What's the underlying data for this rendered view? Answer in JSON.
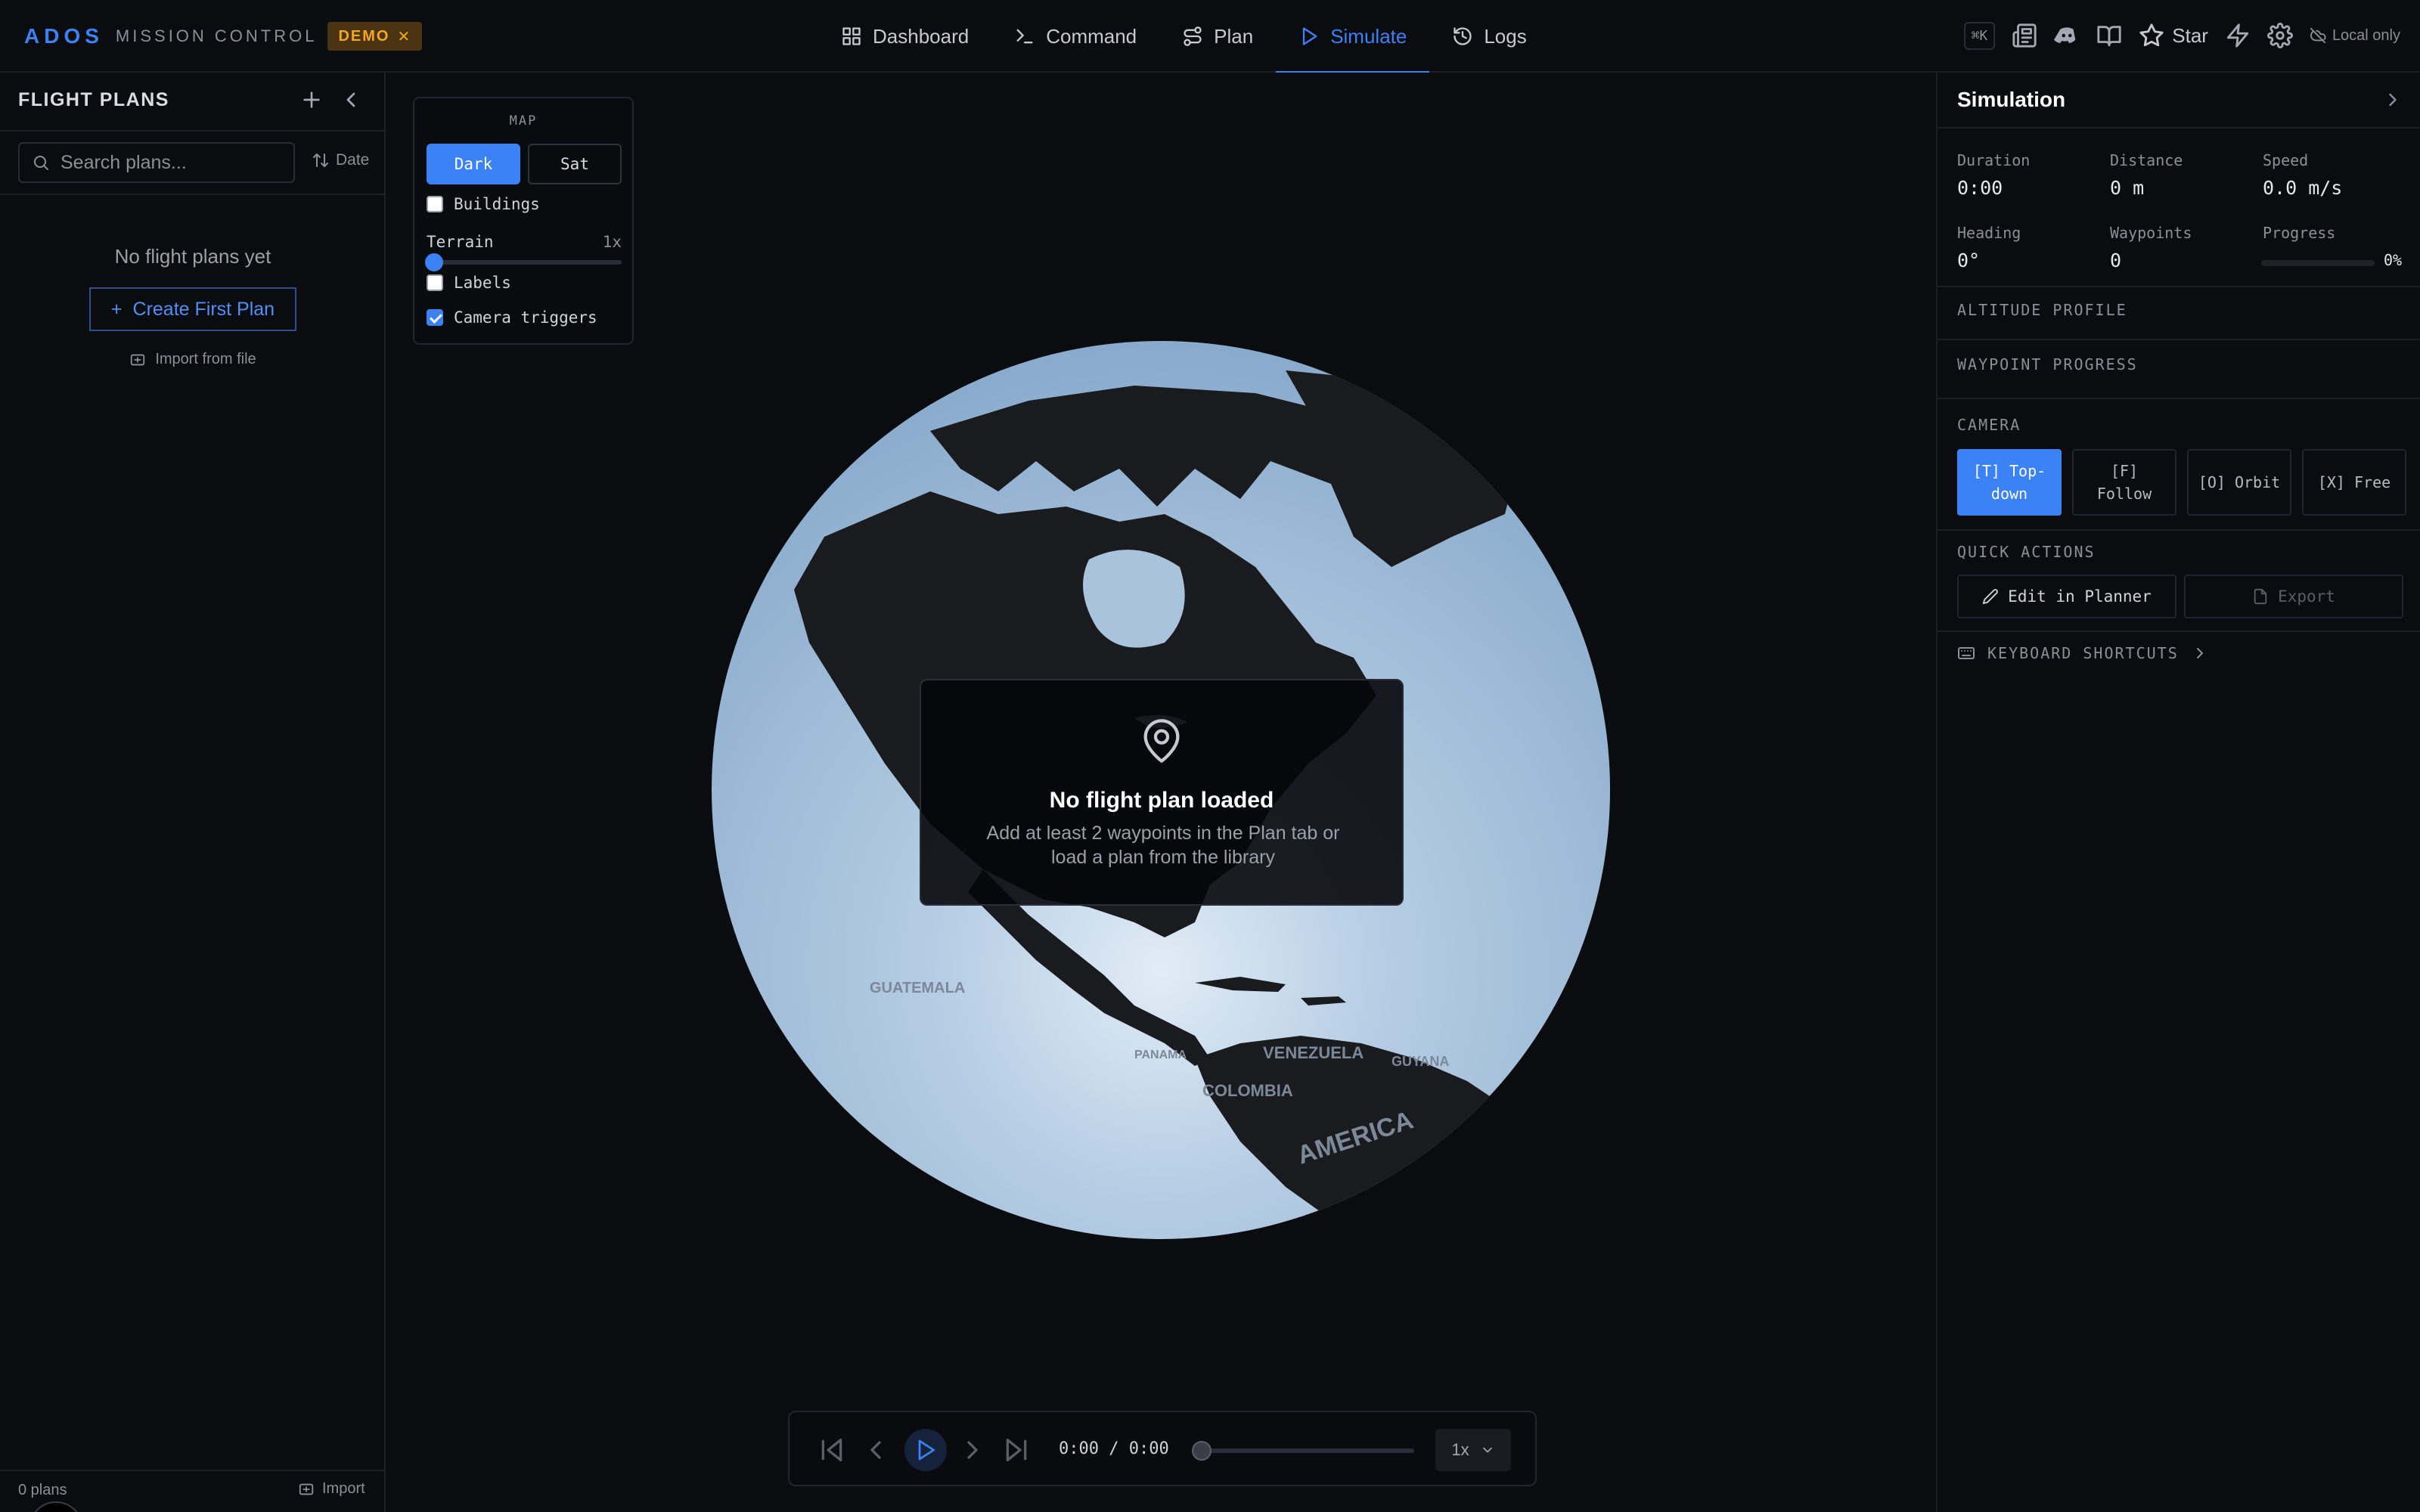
{
  "brand": {
    "name": "ADOS",
    "subtitle": "MISSION CONTROL",
    "badge": "DEMO"
  },
  "nav": {
    "tabs": [
      {
        "label": "Dashboard",
        "icon": "grid-icon"
      },
      {
        "label": "Command",
        "icon": "terminal-icon"
      },
      {
        "label": "Plan",
        "icon": "route-icon"
      },
      {
        "label": "Simulate",
        "icon": "play-icon",
        "active": true
      },
      {
        "label": "Logs",
        "icon": "history-icon"
      }
    ]
  },
  "topbar": {
    "shortcut": "⌘K",
    "star_label": "Star",
    "local_only": "Local only"
  },
  "sidebar": {
    "title": "FLIGHT PLANS",
    "search_placeholder": "Search plans...",
    "sort_label": "Date",
    "empty_text": "No flight plans yet",
    "create_label": "Create First Plan",
    "import_file_label": "Import from file",
    "plan_count": "0 plans",
    "import_label": "Import"
  },
  "map_panel": {
    "title": "MAP",
    "dark_label": "Dark",
    "sat_label": "Sat",
    "buildings_label": "Buildings",
    "buildings_checked": false,
    "terrain_label": "Terrain",
    "terrain_value": "1x",
    "labels_label": "Labels",
    "labels_checked": false,
    "camera_triggers_label": "Camera triggers",
    "camera_triggers_checked": true
  },
  "overlay": {
    "title": "No flight plan loaded",
    "message": "Add at least 2 waypoints in the Plan tab or load a plan from the library"
  },
  "globe": {
    "country_labels": [
      "GUATEMALA",
      "VENEZUELA",
      "GUYANA",
      "COLOMBIA",
      "AMERICA",
      "PANAMA"
    ]
  },
  "playback": {
    "time": "0:00 / 0:00",
    "speed": "1x",
    "progress": 0
  },
  "simulation": {
    "title": "Simulation",
    "stats": [
      {
        "label": "Duration",
        "value": "0:00"
      },
      {
        "label": "Distance",
        "value": "0 m"
      },
      {
        "label": "Speed",
        "value": "0.0 m/s"
      },
      {
        "label": "Heading",
        "value": "0°"
      },
      {
        "label": "Waypoints",
        "value": "0"
      }
    ],
    "progress_label": "Progress",
    "progress_text": "0%",
    "progress_value": 0,
    "altitude_profile": "ALTITUDE PROFILE",
    "waypoint_progress": "WAYPOINT PROGRESS",
    "camera_title": "CAMERA",
    "camera_modes": [
      {
        "label": "[T] Top-down",
        "active": true
      },
      {
        "label": "[F] Follow"
      },
      {
        "label": "[O] Orbit"
      },
      {
        "label": "[X] Free"
      }
    ],
    "quick_actions_title": "QUICK ACTIONS",
    "edit_label": "Edit in Planner",
    "export_label": "Export",
    "keyboard_shortcuts": "KEYBOARD SHORTCUTS"
  },
  "colors": {
    "accent": "#3b82f6",
    "badge_bg": "#4a3411",
    "badge_fg": "#f5a623",
    "background": "#0b0c10",
    "ocean": "#9cbcdc",
    "land": "#1a1b1e"
  }
}
